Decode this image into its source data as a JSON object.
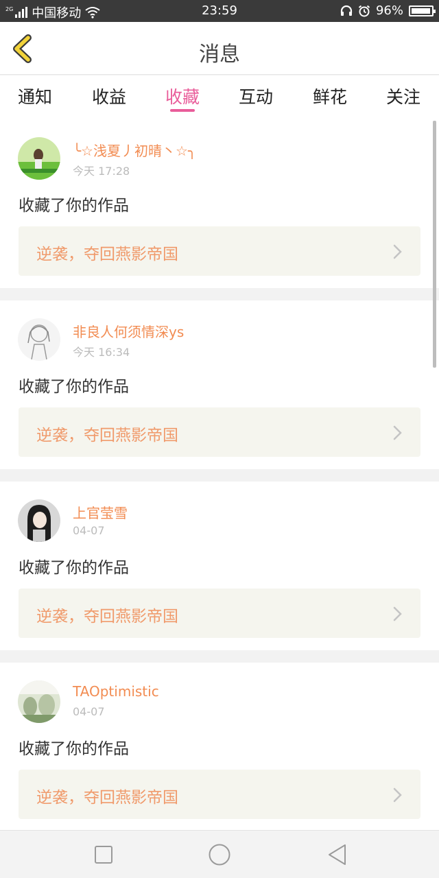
{
  "status_bar": {
    "network_tag": "2G",
    "carrier": "中国移动",
    "time": "23:59",
    "battery": "96%",
    "battery_level": 0.96,
    "icons": [
      "signal-icon",
      "wifi-icon",
      "headphones-icon",
      "alarm-icon",
      "battery-icon"
    ]
  },
  "header": {
    "title": "消息",
    "back_icon": "chevron-left-icon"
  },
  "tabs": [
    {
      "label": "通知"
    },
    {
      "label": "收益"
    },
    {
      "label": "收藏",
      "active": true
    },
    {
      "label": "互动"
    },
    {
      "label": "鲜花"
    },
    {
      "label": "关注"
    }
  ],
  "messages": [
    {
      "username": "╰☆浅夏丿初晴丶☆╮",
      "time": "今天 17:28",
      "action": "收藏了你的作品",
      "work_title": "逆袭，夺回燕影帝国"
    },
    {
      "username": "非良人何须情深ys",
      "time": "今天 16:34",
      "action": "收藏了你的作品",
      "work_title": "逆袭，夺回燕影帝国"
    },
    {
      "username": "上官莹雪",
      "time": "04-07",
      "action": "收藏了你的作品",
      "work_title": "逆袭，夺回燕影帝国"
    },
    {
      "username": "TAOptimistic",
      "time": "04-07",
      "action": "收藏了你的作品",
      "work_title": "逆袭，夺回燕影帝国"
    }
  ],
  "nav": {
    "icons": [
      "recent-apps-icon",
      "home-icon",
      "back-icon"
    ]
  },
  "colors": {
    "accent": "#e95d9a",
    "username": "#f28c52",
    "work_title": "#f09a6b",
    "back_arrow": "#f2d33a"
  }
}
